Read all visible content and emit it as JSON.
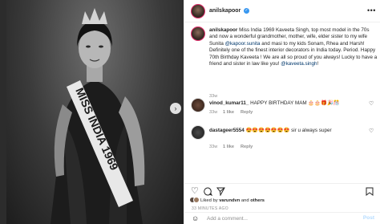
{
  "photo": {
    "sash_text": "MISS INDIA 1969",
    "next_icon": "chevron-right-icon"
  },
  "header": {
    "username": "anilskapoor",
    "more_icon": "more-horizontal-icon"
  },
  "caption": {
    "username": "anilskapoor",
    "part1": " Miss India 1969 Kaveeta Singh, top most model in the 70s and now a wonderful grandmother, mother, wife, elder sister to my wife Sunita ",
    "mention1": "@kapoor.sunita",
    "part2": " and masi to my kids Sonam, Rhea and Harsh! Definitely one of the finest interior decorators in India today. Period. Happy 70th Birthday Kaveeta ! We are all so proud of you always! Lucky to have a friend and sister in law like you! ",
    "mention2": "@kaveeta.singh",
    "part3": "!",
    "age": "33w"
  },
  "comments": [
    {
      "username": "vinod_kumar11_",
      "text": " HAPPY BIRTHDAY MAM 🎂🎂🎁🎉🎊",
      "age": "33w",
      "likes": "1 like",
      "reply": "Reply"
    },
    {
      "username": "dastageer5554",
      "text": " 😍😍😍😍😍😍😍 sir u always super",
      "age": "33w",
      "likes": "1 like",
      "reply": "Reply"
    }
  ],
  "actions": {
    "like_icon": "heart-icon",
    "comment_icon": "comment-icon",
    "share_icon": "share-icon",
    "save_icon": "bookmark-icon"
  },
  "likes": {
    "prefix": "Liked by ",
    "user": "varundvn",
    "middle": " and ",
    "others": "others"
  },
  "timestamp": "33 MINUTES AGO",
  "add_comment": {
    "placeholder": "Add a comment...",
    "post_label": "Post",
    "emoji_icon": "smiley-icon"
  }
}
